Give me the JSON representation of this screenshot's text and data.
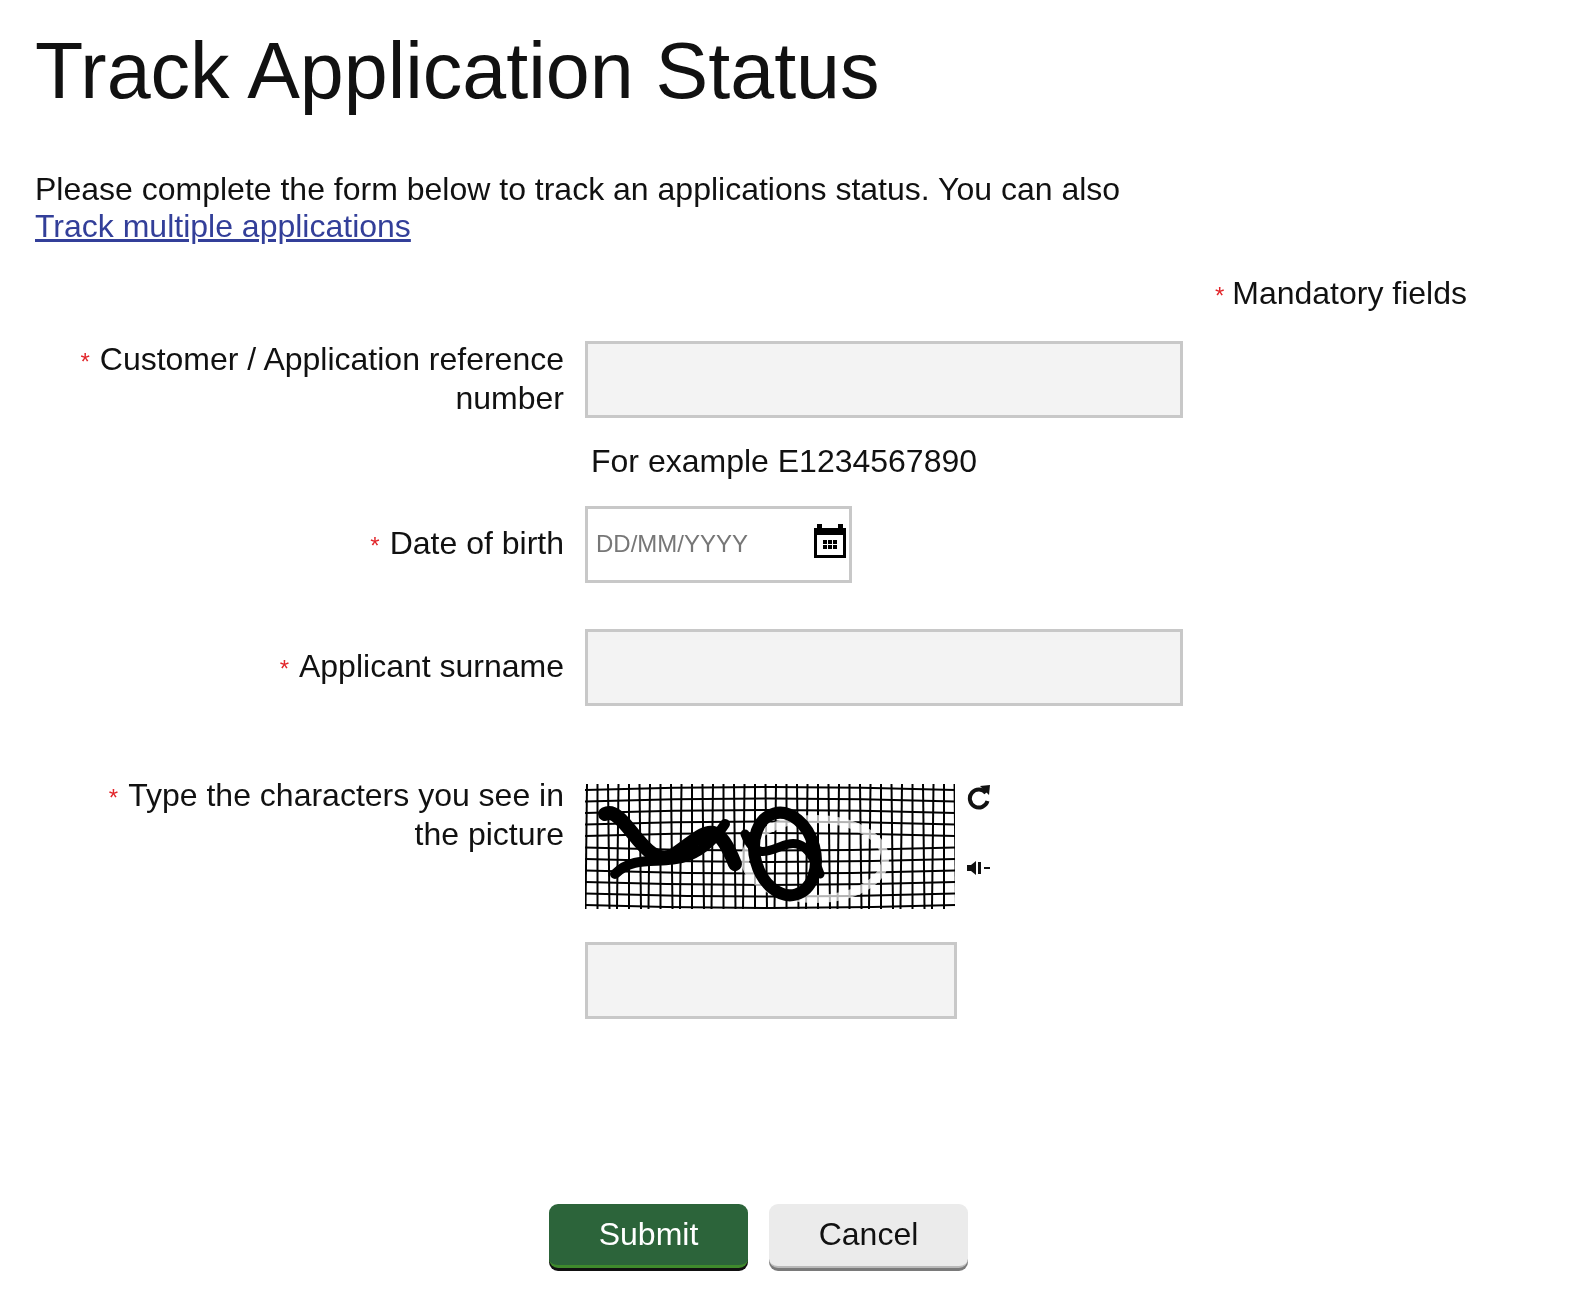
{
  "page": {
    "title": "Track Application Status"
  },
  "intro": {
    "text": "Please complete the form below to track an applications status. You can also",
    "link": "Track multiple applications"
  },
  "mandatory_note": {
    "mark": "*",
    "text": "Mandatory fields"
  },
  "fields": [
    {
      "kind": "text",
      "mark": "*",
      "label": "Customer / Application reference number",
      "hint": "For example E1234567890"
    },
    {
      "kind": "date",
      "mark": "*",
      "label": "Date of birth",
      "placeholder": "DD/MM/YYYY"
    },
    {
      "kind": "text",
      "mark": "*",
      "label": "Applicant surname"
    },
    {
      "kind": "captcha",
      "mark": "*",
      "label": "Type the characters you see in the picture"
    }
  ],
  "buttons": [
    {
      "kind": "primary",
      "label": "Submit"
    },
    {
      "kind": "secondary",
      "label": "Cancel"
    }
  ]
}
